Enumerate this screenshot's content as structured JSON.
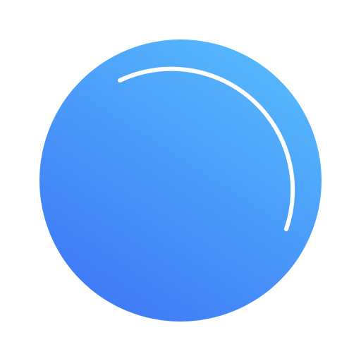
{
  "icon": {
    "name": "blue-sphere-icon",
    "colors": {
      "background": "#ffffff",
      "gradient_top_right": "#55B6FC",
      "gradient_bottom_left": "#3F7BF7",
      "highlight": "#ffffff"
    }
  }
}
